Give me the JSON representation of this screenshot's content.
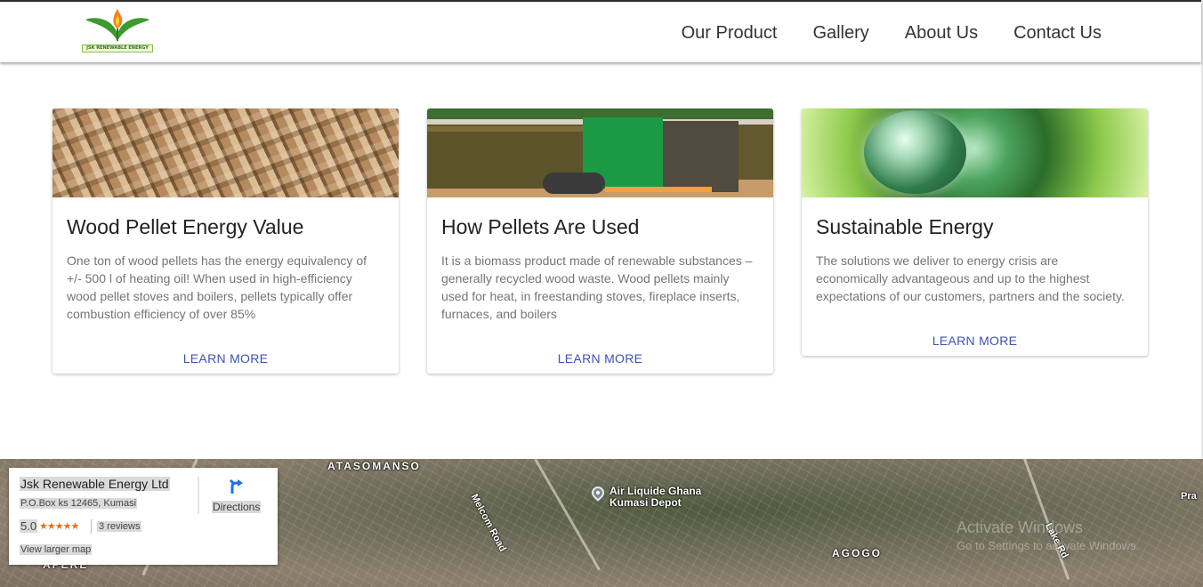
{
  "header": {
    "logo_text": "JSK RENEWABLE ENERGY",
    "nav": [
      {
        "label": "Our Product"
      },
      {
        "label": "Gallery"
      },
      {
        "label": "About Us"
      },
      {
        "label": "Contact Us"
      }
    ]
  },
  "cards": [
    {
      "title": "Wood Pellet Energy Value",
      "text": "One ton of wood pellets has the energy equivalency of +/- 500 l of heating oil! When used in high-efficiency wood pellet stoves and boilers, pellets typically offer combustion efficiency of over 85%",
      "action": "LEARN MORE"
    },
    {
      "title": "How Pellets Are Used",
      "text": "It is a biomass product made of renewable substances – generally recycled wood waste. Wood pellets mainly used for heat, in freestanding stoves, fireplace inserts, furnaces, and boilers",
      "action": "LEARN MORE"
    },
    {
      "title": "Sustainable Energy",
      "text": "The solutions we deliver to energy crisis are economically advantageous and up to the highest expectations of our customers, partners and the society.",
      "action": "LEARN MORE"
    }
  ],
  "map": {
    "place_name": "Jsk Renewable Energy Ltd",
    "address": "P.O.Box ks 12465, Kumasi",
    "rating": "5.0",
    "stars": "★★★★★",
    "reviews": "3 reviews",
    "larger_map": "View larger map",
    "directions": "Directions",
    "labels": {
      "atasomanso": "ATASOMANSO",
      "agogo": "AGOGO",
      "apere": "APERE",
      "melcom_road": "Melcom Road",
      "lake_rd": "Lake Rd",
      "poi_line1": "Air Liquide Ghana",
      "poi_line2": "Kumasi Depot",
      "edge": "Pra"
    }
  },
  "watermark": {
    "line1": "Activate Windows",
    "line2": "Go to Settings to activate Windows."
  },
  "colors": {
    "accent": "#3f51b5",
    "star": "#e7711b"
  }
}
